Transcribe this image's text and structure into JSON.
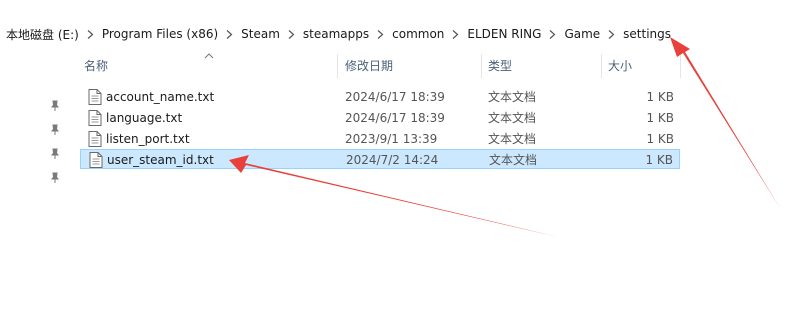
{
  "breadcrumb": [
    "本地磁盘 (E:)",
    "Program Files (x86)",
    "Steam",
    "steamapps",
    "common",
    "ELDEN RING",
    "Game",
    "settings"
  ],
  "columns": {
    "name": "名称",
    "date": "修改日期",
    "type": "类型",
    "size": "大小"
  },
  "files": [
    {
      "name": "account_name.txt",
      "date": "2024/6/17 18:39",
      "type": "文本文档",
      "size": "1 KB",
      "selected": false
    },
    {
      "name": "language.txt",
      "date": "2024/6/17 18:39",
      "type": "文本文档",
      "size": "1 KB",
      "selected": false
    },
    {
      "name": "listen_port.txt",
      "date": "2023/9/1 13:39",
      "type": "文本文档",
      "size": "1 KB",
      "selected": false
    },
    {
      "name": "user_steam_id.txt",
      "date": "2024/7/2 14:24",
      "type": "文本文档",
      "size": "1 KB",
      "selected": true
    }
  ],
  "colors": {
    "selection_bg": "#cce8ff",
    "selection_border": "#99d1ff",
    "arrow": "#e8403a"
  },
  "icons": {
    "pin": "pin-icon",
    "file": "text-file-icon",
    "separator": "chevron-right-icon",
    "sort": "sort-up-icon"
  }
}
